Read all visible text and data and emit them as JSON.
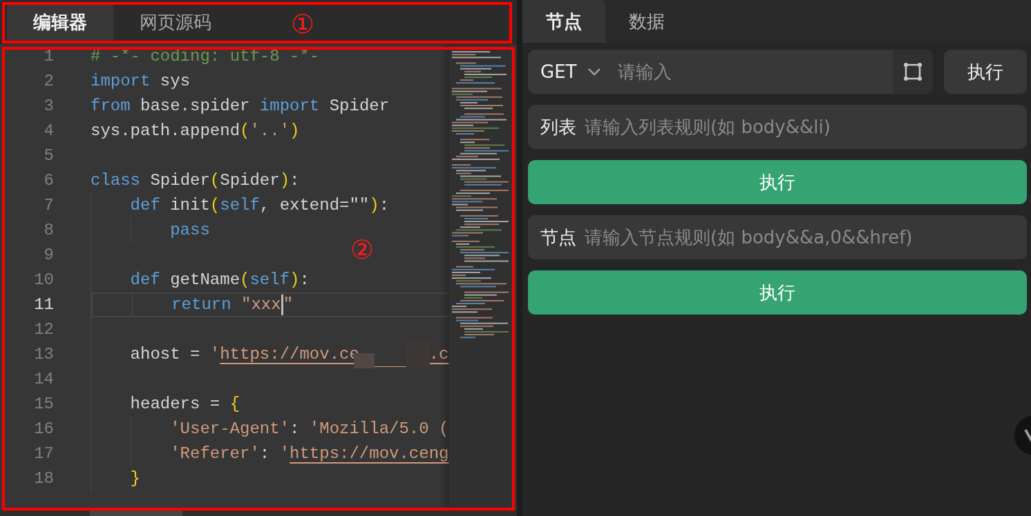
{
  "left_tabs": [
    {
      "label": "编辑器",
      "selected": true
    },
    {
      "label": "网页源码",
      "selected": false
    }
  ],
  "editor": {
    "lines": [
      {
        "number": "1",
        "current": false,
        "tokens": [
          {
            "kind": "comment",
            "text": "# -*- coding: utf-8 -*-"
          }
        ]
      },
      {
        "number": "2",
        "current": false,
        "tokens": [
          {
            "kind": "keyword",
            "text": "import"
          },
          {
            "kind": "plain",
            "text": " sys"
          }
        ]
      },
      {
        "number": "3",
        "current": false,
        "tokens": [
          {
            "kind": "keyword",
            "text": "from"
          },
          {
            "kind": "plain",
            "text": " base.spider "
          },
          {
            "kind": "keyword",
            "text": "import"
          },
          {
            "kind": "plain",
            "text": " Spider"
          }
        ]
      },
      {
        "number": "4",
        "current": false,
        "tokens": [
          {
            "kind": "plain",
            "text": "sys.path.append"
          },
          {
            "kind": "bracket",
            "text": "("
          },
          {
            "kind": "string",
            "text": "'..'"
          },
          {
            "kind": "bracket",
            "text": ")"
          }
        ]
      },
      {
        "number": "5",
        "current": false
      },
      {
        "number": "6",
        "current": false,
        "tokens": [
          {
            "kind": "keyword",
            "text": "class"
          },
          {
            "kind": "plain",
            "text": " Spider"
          },
          {
            "kind": "bracket",
            "text": "("
          },
          {
            "kind": "plain",
            "text": "Spider"
          },
          {
            "kind": "bracket",
            "text": ")"
          },
          {
            "kind": "plain",
            "text": ":"
          }
        ]
      },
      {
        "number": "7",
        "current": false,
        "tokens": [
          {
            "kind": "guide"
          },
          {
            "kind": "keyword",
            "text": "def"
          },
          {
            "kind": "plain",
            "text": " init"
          },
          {
            "kind": "bracket",
            "text": "("
          },
          {
            "kind": "keyword",
            "text": "self"
          },
          {
            "kind": "plain",
            "text": ", extend=\"\""
          },
          {
            "kind": "bracket",
            "text": ")"
          },
          {
            "kind": "plain",
            "text": ":"
          }
        ]
      },
      {
        "number": "8",
        "current": false,
        "tokens": [
          {
            "kind": "guide"
          },
          {
            "kind": "guide"
          },
          {
            "kind": "keyword",
            "text": "pass"
          }
        ]
      },
      {
        "number": "9",
        "current": false,
        "tokens": [
          {
            "kind": "guide"
          }
        ]
      },
      {
        "number": "10",
        "current": false,
        "tokens": [
          {
            "kind": "guide"
          },
          {
            "kind": "keyword",
            "text": "def"
          },
          {
            "kind": "plain",
            "text": " getName"
          },
          {
            "kind": "bracket",
            "text": "("
          },
          {
            "kind": "keyword",
            "text": "self"
          },
          {
            "kind": "bracket",
            "text": ")"
          },
          {
            "kind": "plain",
            "text": ":"
          }
        ]
      },
      {
        "number": "11",
        "current": true,
        "tokens": [
          {
            "kind": "guide"
          },
          {
            "kind": "guide"
          },
          {
            "kind": "keyword",
            "text": "return"
          },
          {
            "kind": "string",
            "text": " \"xxx"
          },
          {
            "kind": "cursor"
          },
          {
            "kind": "string",
            "text": "\""
          }
        ]
      },
      {
        "number": "12",
        "current": false,
        "tokens": [
          {
            "kind": "guide"
          }
        ]
      },
      {
        "number": "13",
        "current": false,
        "tokens": [
          {
            "kind": "guide"
          },
          {
            "kind": "plain",
            "text": "ahost = "
          },
          {
            "kind": "string",
            "text": "'"
          },
          {
            "kind": "url",
            "text": "https://mov.ce"
          },
          {
            "kind": "redacted"
          },
          {
            "kind": "url",
            "text": ".c"
          }
        ]
      },
      {
        "number": "14",
        "current": false,
        "tokens": [
          {
            "kind": "guide"
          }
        ]
      },
      {
        "number": "15",
        "current": false,
        "tokens": [
          {
            "kind": "guide"
          },
          {
            "kind": "plain",
            "text": "headers = "
          },
          {
            "kind": "bracket",
            "text": "{"
          }
        ]
      },
      {
        "number": "16",
        "current": false,
        "tokens": [
          {
            "kind": "guide"
          },
          {
            "kind": "guide"
          },
          {
            "kind": "string",
            "text": "'User-Agent'"
          },
          {
            "kind": "plain",
            "text": ": "
          },
          {
            "kind": "string",
            "text": "'Mozilla/5.0 ("
          }
        ]
      },
      {
        "number": "17",
        "current": false,
        "tokens": [
          {
            "kind": "guide"
          },
          {
            "kind": "guide"
          },
          {
            "kind": "string",
            "text": "'Referer'"
          },
          {
            "kind": "plain",
            "text": ": "
          },
          {
            "kind": "string",
            "text": "'"
          },
          {
            "kind": "url",
            "text": "https://mov.ceng"
          }
        ]
      },
      {
        "number": "18",
        "current": false,
        "tokens": [
          {
            "kind": "guide"
          },
          {
            "kind": "bracket",
            "text": "}"
          }
        ]
      }
    ]
  },
  "annotations": [
    {
      "kind": "tab_bar",
      "label": "①"
    },
    {
      "kind": "editor",
      "label": "②"
    }
  ],
  "right_tabs": [
    {
      "label": "节点",
      "selected": true
    },
    {
      "label": "数据",
      "selected": false
    }
  ],
  "request": {
    "method": "GET",
    "placeholder": "请输入",
    "button": "执行"
  },
  "rules": [
    {
      "label": "列表",
      "placeholder": "请输入列表规则(如 body&&li)",
      "button": "执行"
    },
    {
      "label": "节点",
      "placeholder": "请输入节点规则(如 body&&a,0&&href)",
      "button": "执行"
    }
  ]
}
